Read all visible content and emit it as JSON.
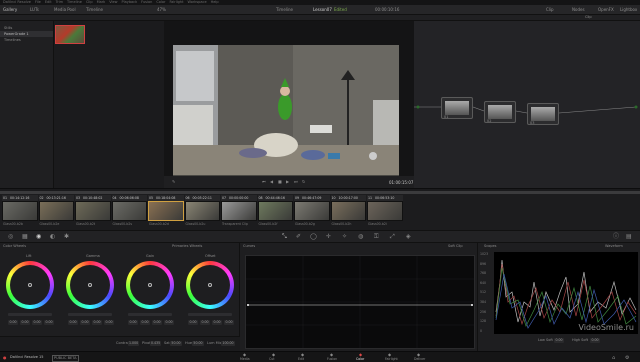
{
  "menu": [
    "DaVinci Resolve",
    "File",
    "Edit",
    "Trim",
    "Timeline",
    "Clip",
    "Mark",
    "View",
    "Playback",
    "Fusion",
    "Color",
    "Fairlight",
    "Workspace",
    "Help"
  ],
  "toolbar": {
    "gallery": "Gallery",
    "luts": "LUTs",
    "media_pool": "Media Pool",
    "timeline_btn": "Timeline",
    "zoom": "47%",
    "timeline_dd": "Timeline",
    "project": "Lesson07",
    "edited": "Edited",
    "timecode_top": "00:00:10:16",
    "clip": "Clip",
    "nodes": "Nodes",
    "openfx": "OpenFX",
    "lightbox": "Lightbox",
    "clip_dd": "Clip"
  },
  "album": {
    "stills": "Stills",
    "powergrade": "PowerGrade 1",
    "timelines": "Timelines"
  },
  "viewer": {
    "timecode": "01:00:15:07"
  },
  "nodes": [
    {
      "label": "01"
    },
    {
      "label": "02"
    },
    {
      "label": "03"
    }
  ],
  "clips": [
    {
      "n": "01",
      "tc": "00:14:12:16",
      "color": "#6a6a64"
    },
    {
      "n": "02",
      "tc": "00:13:21:16",
      "color": "#7a6e58"
    },
    {
      "n": "03",
      "tc": "00:10:48:02",
      "color": "#6e6a58"
    },
    {
      "n": "04",
      "tc": "00:06:06:08",
      "color": "#6c6c66"
    },
    {
      "n": "05",
      "tc": "00:18:04:08",
      "color": "#8a7052"
    },
    {
      "n": "06",
      "tc": "00:05:22:11",
      "color": "#8a8574"
    },
    {
      "n": "07",
      "tc": "00:00:00:00",
      "color": "#9a9a9a"
    },
    {
      "n": "08",
      "tc": "00:44:46:16",
      "color": "#6e7a5e"
    },
    {
      "n": "09",
      "tc": "00:46:47:09",
      "color": "#7c7a72"
    },
    {
      "n": "10",
      "tc": "10:00:17:00",
      "color": "#7a6e5c"
    },
    {
      "n": "11",
      "tc": "00:06:53:10",
      "color": "#6c645a"
    }
  ],
  "clip_names": [
    "Glass00-b2b",
    "Glass00-b2e",
    "Glass00-b2t",
    "Glass00-b2s",
    "Glass00-b2d",
    "Glass00-b2u",
    "Transparent Clip",
    "Glass00-b2f",
    "Glass00-b2g",
    "Glass00-b2h",
    "Glass00-b2i"
  ],
  "colorwheels": {
    "title": "Color Wheels",
    "primaries": "Primaries Wheels",
    "lift": "Lift",
    "gamma": "Gamma",
    "gain": "Gain",
    "offset": "Offset",
    "vals": [
      "0.00",
      "0.00",
      "0.00",
      "0.00"
    ],
    "contrast": "Contrast",
    "contrast_v": "1.000",
    "pivot": "Pivot",
    "pivot_v": "0.435",
    "sat": "Sat",
    "sat_v": "50.00",
    "hue": "Hue",
    "hue_v": "50.00",
    "lummix": "Lum Mix",
    "lummix_v": "100.00"
  },
  "curves": {
    "title": "Curves",
    "softclip": "Soft Clip"
  },
  "scopes": {
    "title": "Scopes",
    "mode": "Waveform",
    "labels": [
      "1023",
      "896",
      "768",
      "640",
      "512",
      "384",
      "256",
      "128",
      "0"
    ],
    "lowclip": "Low Soft",
    "highclip": "High Soft",
    "v0": "0.00"
  },
  "pages": [
    "Media",
    "Cut",
    "Edit",
    "Fusion",
    "Color",
    "Fairlight",
    "Deliver"
  ],
  "bottom": {
    "app": "DaVinci Resolve 15",
    "beta": "PUBLIC BETA"
  },
  "watermark": "VideoSmile.ru"
}
